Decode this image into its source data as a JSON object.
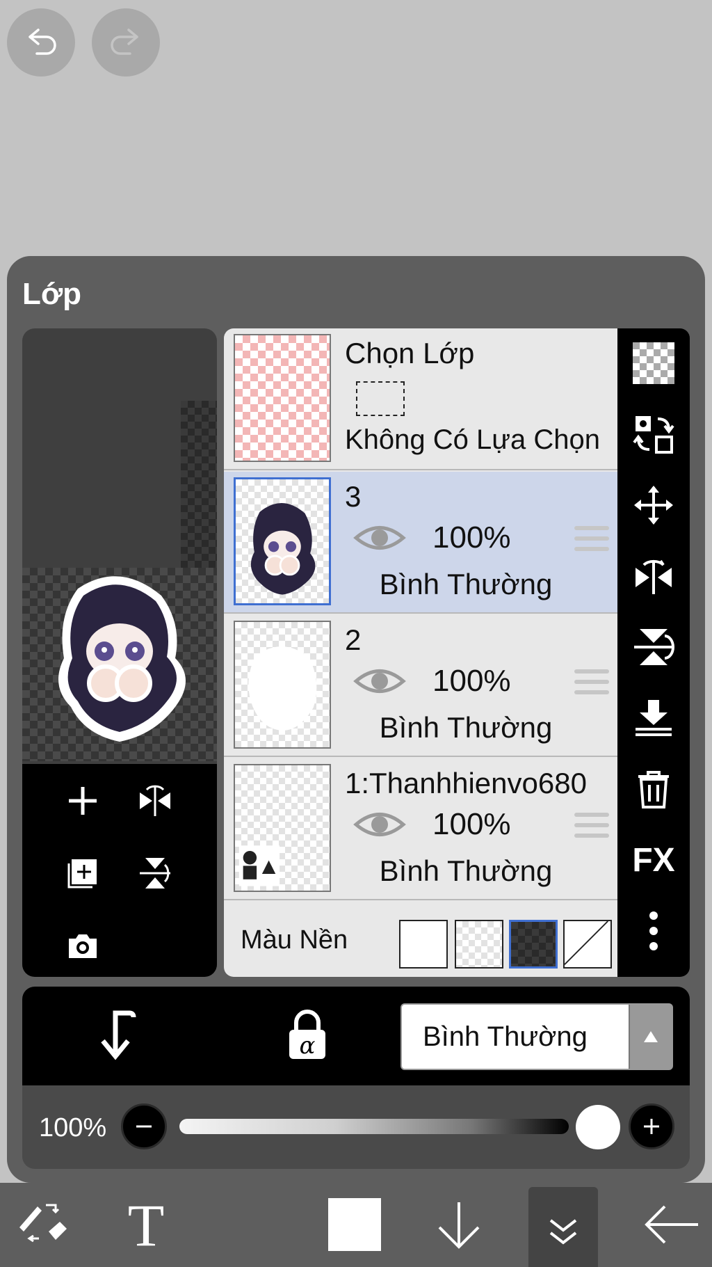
{
  "toolbar_top": {
    "undo": "undo-icon",
    "redo": "redo-icon"
  },
  "panel": {
    "title": "Lớp",
    "selection_layer": {
      "title": "Chọn Lớp",
      "status": "Không Có Lựa Chọn"
    },
    "layers": [
      {
        "name": "3",
        "opacity": "100%",
        "blend": "Bình Thường",
        "visible": true,
        "selected": true
      },
      {
        "name": "2",
        "opacity": "100%",
        "blend": "Bình Thường",
        "visible": true,
        "selected": false
      },
      {
        "name": "1:Thanhhienvo680",
        "opacity": "100%",
        "blend": "Bình Thường",
        "visible": true,
        "selected": false
      }
    ],
    "background": {
      "label": "Màu Nền",
      "options": [
        "white",
        "checker-light",
        "checker-dark",
        "none"
      ],
      "selected": "checker-dark"
    }
  },
  "blend_mode": {
    "value": "Bình Thường"
  },
  "opacity_slider": {
    "label": "100%",
    "value": 1.0
  },
  "colors": {
    "accent": "#3f6fd1",
    "selected_row": "#cdd6ea",
    "panel": "#5e5e5e"
  }
}
